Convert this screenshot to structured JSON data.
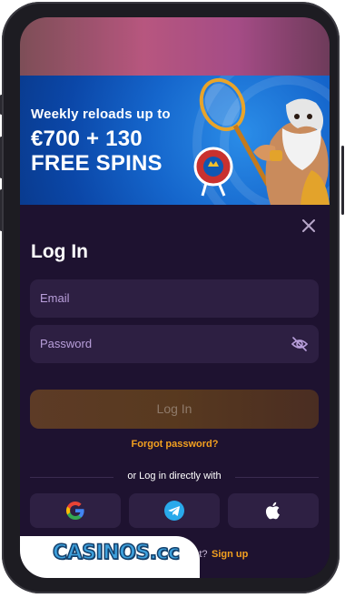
{
  "banner": {
    "line1": "Weekly reloads up to",
    "line2": "€700 + 130",
    "line3": "FREE SPINS"
  },
  "login": {
    "close_icon": "close-icon",
    "title": "Log In",
    "email_placeholder": "Email",
    "password_placeholder": "Password",
    "submit_label": "Log In",
    "forgot_label": "Forgot password?",
    "divider_label": "or Log in directly with",
    "social": [
      "google-icon",
      "telegram-icon",
      "apple-icon"
    ],
    "signup_prompt": "ount?",
    "signup_link": "Sign up"
  },
  "watermark": {
    "logo_text": "CASINOS.cc"
  },
  "colors": {
    "accent": "#f3a01f",
    "sheet_bg": "#1e1230",
    "field_bg": "#2d1f42",
    "banner_blue": "#1566cc"
  }
}
